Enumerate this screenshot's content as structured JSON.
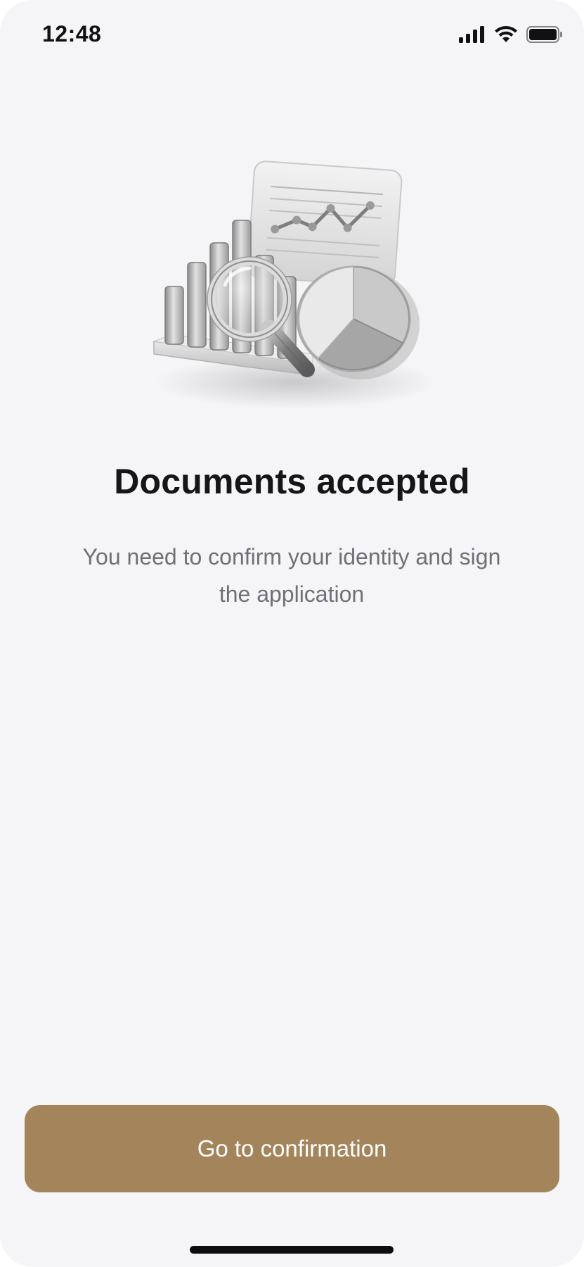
{
  "status_bar": {
    "time": "12:48"
  },
  "main": {
    "illustration_icon": "chart-magnifier-illustration",
    "title": "Documents accepted",
    "subtitle": "You need to confirm your identity and sign the application"
  },
  "footer": {
    "button_label": "Go to confirmation"
  },
  "colors": {
    "background": "#f5f5f8",
    "accent": "#a4845b",
    "title": "#161616",
    "subtitle": "#6f6f75"
  }
}
